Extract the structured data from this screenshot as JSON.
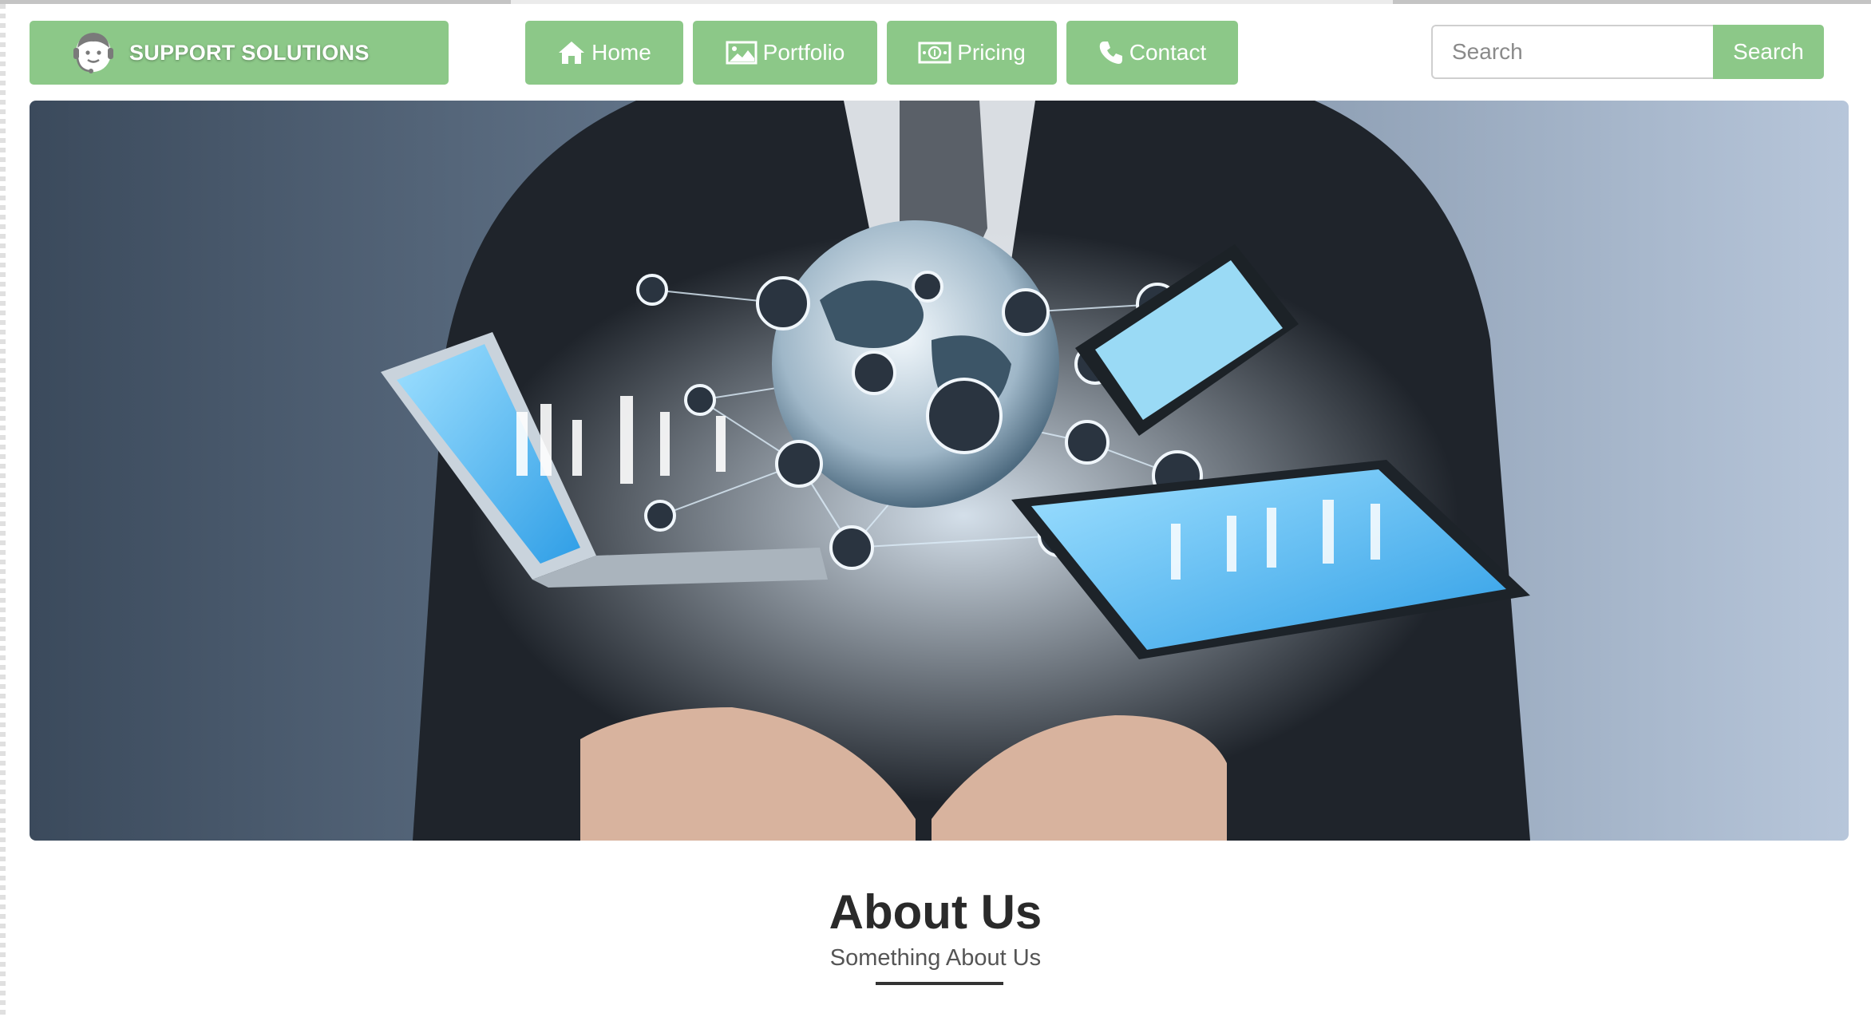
{
  "brand": {
    "name": "SUPPORT SOLUTIONS",
    "icon": "headset-support-icon"
  },
  "nav": [
    {
      "label": "Home",
      "icon": "home-icon"
    },
    {
      "label": "Portfolio",
      "icon": "picture-icon"
    },
    {
      "label": "Pricing",
      "icon": "money-bill-icon"
    },
    {
      "label": "Contact",
      "icon": "phone-icon"
    }
  ],
  "search": {
    "placeholder": "Search",
    "button_label": "Search"
  },
  "hero": {
    "image": "businessman-holding-devices-network-globe"
  },
  "about": {
    "title": "About Us",
    "subtitle": "Something About Us"
  },
  "colors": {
    "accent": "#8cc888",
    "text_dark": "#2a2a2a",
    "text_muted": "#555555"
  }
}
